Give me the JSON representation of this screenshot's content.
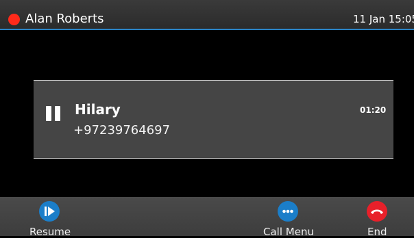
{
  "header": {
    "user_name": "Alan Roberts",
    "datetime": "11 Jan 15:05",
    "status_color": "#ff2a1a",
    "accent_color": "#2a84c6"
  },
  "call": {
    "state_icon": "pause-icon",
    "caller_name": "Hilary",
    "caller_number": "+97239764697",
    "duration": "01:20"
  },
  "softkeys": [
    {
      "label": "Resume",
      "icon": "resume-icon",
      "color": "#1b7ec9"
    },
    {
      "label": "Call Menu",
      "icon": "more-icon",
      "color": "#1b7ec9"
    },
    {
      "label": "End",
      "icon": "hangup-icon",
      "color": "#e8202a"
    }
  ]
}
